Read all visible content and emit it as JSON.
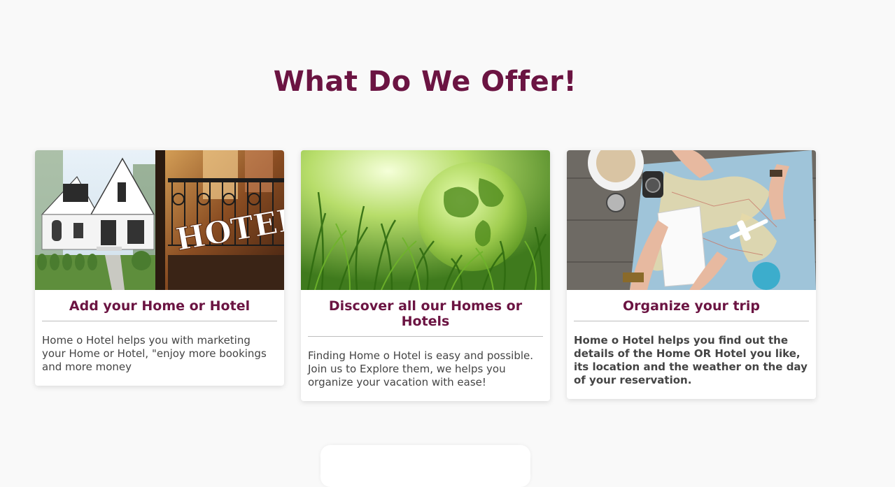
{
  "section": {
    "title": "What Do We Offer!"
  },
  "cards": [
    {
      "title": "Add your Home or Hotel",
      "text": "Home o Hotel helps you with marketing your Home or Hotel, \"enjoy more bookings and more money",
      "image_sign": "HOTEL"
    },
    {
      "title": "Discover all our Homes or Hotels",
      "text": "Finding Home o Hotel is easy and possible. Join us to Explore them, we helps you organize your vacation with ease!"
    },
    {
      "title": "Organize your trip",
      "text": "Home o Hotel helps you find out the details of the Home OR Hotel you like, its location and the weather on the day of your reservation."
    }
  ],
  "colors": {
    "accent": "#6b1442",
    "background": "#f9f9f9",
    "text": "#444444"
  }
}
